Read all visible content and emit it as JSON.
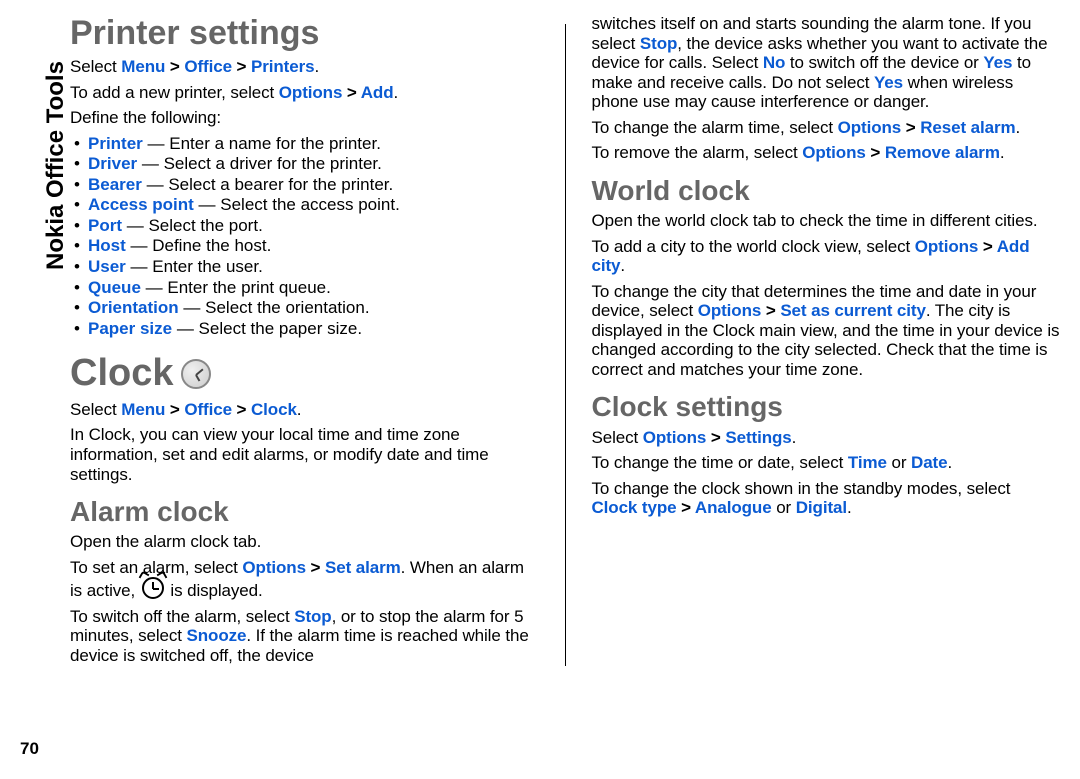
{
  "side_label": "Nokia Office Tools",
  "page_number": "70",
  "left": {
    "printer_heading": "Printer settings",
    "printer_select_prefix": "Select ",
    "menu": "Menu",
    "gt": " > ",
    "office": "Office",
    "printers": "Printers",
    "period": ".",
    "addprinter_prefix": "To add a new printer, select ",
    "options": "Options",
    "add": "Add",
    "define": "Define the following:",
    "items": [
      {
        "t": "Printer",
        "d": " — Enter a name for the printer."
      },
      {
        "t": "Driver",
        "d": " — Select a driver for the printer."
      },
      {
        "t": "Bearer",
        "d": " — Select a bearer for the printer."
      },
      {
        "t": "Access point",
        "d": " — Select the access point."
      },
      {
        "t": "Port",
        "d": " — Select the port."
      },
      {
        "t": "Host",
        "d": " — Define the host."
      },
      {
        "t": "User",
        "d": " — Enter the user."
      },
      {
        "t": "Queue",
        "d": " — Enter the print queue."
      },
      {
        "t": "Orientation",
        "d": " — Select the orientation."
      },
      {
        "t": "Paper size",
        "d": " — Select the paper size."
      }
    ],
    "clock_heading": "Clock",
    "clock_select_prefix": "Select ",
    "clock": "Clock",
    "clock_intro": "In Clock, you can view your local time and time zone information, set and edit alarms, or modify date and time settings.",
    "alarm_heading": "Alarm clock",
    "alarm_open": "Open the alarm clock tab.",
    "alarm_set_1": "To set an alarm, select ",
    "set_alarm": "Set alarm",
    "alarm_set_2": ". When an alarm is active, ",
    "alarm_set_3": " is displayed.",
    "alarm_switch_1": "To switch off the alarm, select ",
    "stop": "Stop",
    "alarm_switch_2": ", or to stop the alarm for 5 minutes, select ",
    "snooze": "Snooze",
    "alarm_switch_3": ". If the alarm time is reached while the device is switched off, the device"
  },
  "right": {
    "cont_1": "switches itself on and starts sounding the alarm tone. If you select ",
    "stop": "Stop",
    "cont_2": ", the device asks whether you want to activate the device for calls. Select ",
    "no": "No",
    "cont_3": " to switch off the device or ",
    "yes": "Yes",
    "cont_4": " to make and receive calls. Do not select ",
    "cont_5": " when wireless phone use may cause interference or danger.",
    "change_1": "To change the alarm time, select ",
    "options": "Options",
    "gt": " > ",
    "reset_alarm": "Reset alarm",
    "period": ".",
    "remove_1": "To remove the alarm, select ",
    "remove_alarm": "Remove alarm",
    "world_heading": "World clock",
    "world_open": "Open the world clock tab to check the time in different cities.",
    "world_add_1": "To add a city to the world clock view, select ",
    "add_city": "Add city",
    "world_change_1": "To change the city that determines the time and date in your device, select ",
    "set_current": "Set as current city",
    "world_change_2": ". The city is displayed in the Clock main view, and the time in your device is changed according to the city selected. Check that the time is correct and matches your time zone.",
    "clockset_heading": "Clock settings",
    "cs_select_1": "Select ",
    "settings": "Settings",
    "cs_time_1": "To change the time or date, select ",
    "time": "Time",
    "or": " or ",
    "date": "Date",
    "cs_type_1": "To change the clock shown in the standby modes, select ",
    "clock_type": "Clock type",
    "analogue": "Analogue",
    "digital": "Digital"
  }
}
